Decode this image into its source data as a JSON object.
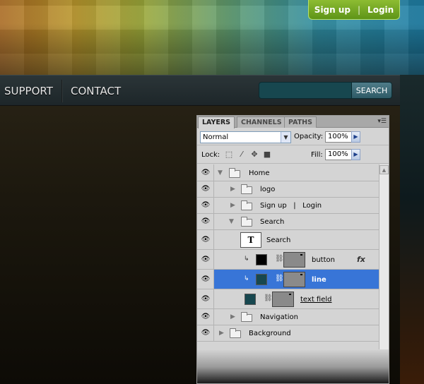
{
  "header": {
    "auth": {
      "signup_label": "Sign up",
      "separator": "|",
      "login_label": "Login"
    }
  },
  "nav": {
    "items": [
      {
        "label": "SUPPORT"
      },
      {
        "label": "CONTACT"
      }
    ],
    "search_button_label": "SEARCH"
  },
  "layers_panel": {
    "tabs": [
      {
        "label": "LAYERS"
      },
      {
        "label": "CHANNELS"
      },
      {
        "label": "PATHS"
      }
    ],
    "blend_mode": "Normal",
    "opacity_label": "Opacity:",
    "opacity_value": "100%",
    "lock_label": "Lock:",
    "fill_label": "Fill:",
    "fill_value": "100%",
    "layers": [
      {
        "name": "Home",
        "type": "group",
        "expanded": true
      },
      {
        "name": "logo",
        "type": "group",
        "expanded": false
      },
      {
        "name": "Sign up   |   Login",
        "type": "group",
        "expanded": false
      },
      {
        "name": "Search",
        "type": "group",
        "expanded": true
      },
      {
        "name": "Search",
        "type": "text",
        "thumb": "T"
      },
      {
        "name": "button",
        "type": "layer",
        "fx": "fx",
        "color": "#000000"
      },
      {
        "name": "line",
        "type": "layer",
        "selected": true,
        "color": "#17474f"
      },
      {
        "name": "text field",
        "type": "layer",
        "color": "#17474f"
      },
      {
        "name": "Navigation",
        "type": "group",
        "expanded": false
      },
      {
        "name": "Background",
        "type": "group",
        "expanded": false
      }
    ]
  },
  "colors": {
    "auth_green": "#7bb02a",
    "selection_blue": "#3875d7",
    "search_teal": "#17474f"
  }
}
